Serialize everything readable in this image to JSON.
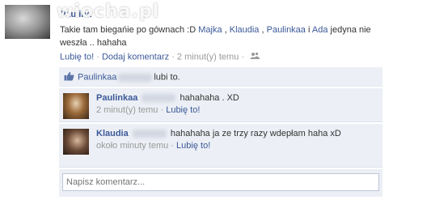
{
  "post": {
    "author": "Paulina",
    "text_before": "Takie tam biegańie po gównach :D ",
    "tags": [
      "Majka",
      "Klaudia",
      "Paulinkaa",
      "Ada"
    ],
    "sep1": " , ",
    "sep2": " , ",
    "sep3": " i ",
    "text_after": " jedyna nie weszła .. hahaha",
    "actions": {
      "like": "Lubię to!",
      "dot1": " · ",
      "comment": "Dodaj komentarz",
      "dot2": " · ",
      "time": "2 minut(y) temu",
      "dot3": " · "
    }
  },
  "watermark": "wiocha.pl",
  "likes": {
    "name": "Paulinkaa",
    "suffix": "lubi to."
  },
  "comments": [
    {
      "author": "Paulinkaa",
      "text": "hahahaha . XD",
      "time": "2 minut(y) temu",
      "dot": " · ",
      "like": "Lubię to!"
    },
    {
      "author": "Klaudia",
      "text": "hahahaha ja ze trzy razy wdepłam haha xD",
      "time": "około minuty temu",
      "dot": " · ",
      "like": "Lubię to!"
    }
  ],
  "comment_box": {
    "placeholder": "Napisz komentarz..."
  },
  "colors": {
    "link": "#3b5998",
    "feedback_bg": "#eceff5",
    "muted": "#999999"
  },
  "icons": {
    "like": "thumbs-up-icon",
    "audience": "people-icon"
  }
}
